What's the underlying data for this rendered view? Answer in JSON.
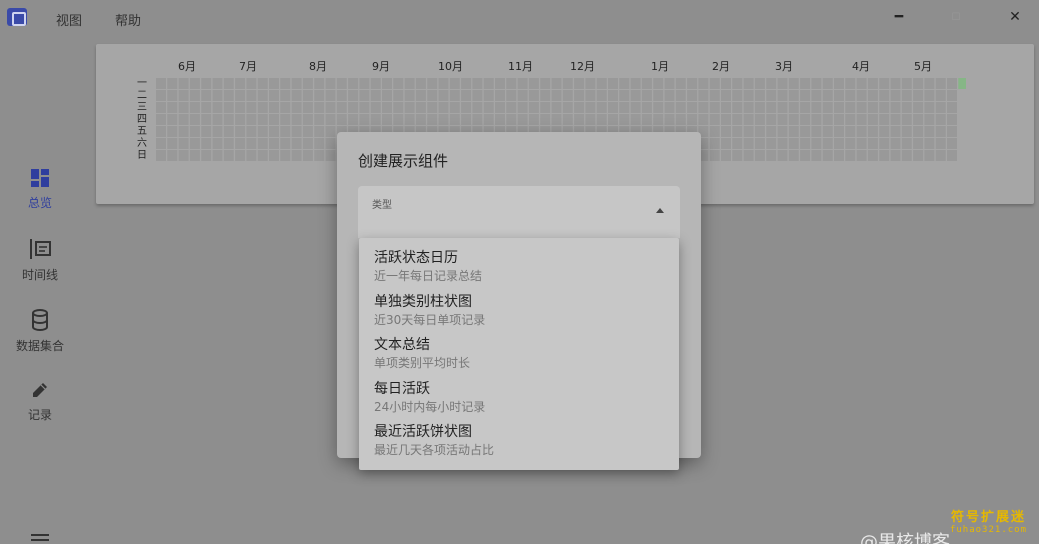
{
  "menu": {
    "view": "视图",
    "help": "帮助"
  },
  "window": {
    "minimize": "━",
    "maximize": "☐",
    "close": "✕"
  },
  "nav": [
    {
      "label": "总览",
      "icon": "dashboard-icon",
      "active": true
    },
    {
      "label": "时间线",
      "icon": "timeline-icon",
      "active": false
    },
    {
      "label": "数据集合",
      "icon": "database-icon",
      "active": false
    },
    {
      "label": "记录",
      "icon": "pencil-icon",
      "active": false
    }
  ],
  "heatmap": {
    "months": [
      "6月",
      "7月",
      "8月",
      "9月",
      "10月",
      "11月",
      "12月",
      "1月",
      "2月",
      "3月",
      "4月",
      "5月"
    ],
    "days": [
      "一",
      "二",
      "三",
      "四",
      "五",
      "六",
      "日"
    ],
    "cell_color": "#999999",
    "active_color": "#86b686"
  },
  "dialog": {
    "title": "创建展示组件",
    "select_label": "类型"
  },
  "options": [
    {
      "title": "活跃状态日历",
      "subtitle": "近一年每日记录总结"
    },
    {
      "title": "单独类别柱状图",
      "subtitle": "近30天每日单项记录"
    },
    {
      "title": "文本总结",
      "subtitle": "单项类别平均时长"
    },
    {
      "title": "每日活跃",
      "subtitle": "24小时内每小时记录"
    },
    {
      "title": "最近活跃饼状图",
      "subtitle": "最近几天各项活动占比"
    }
  ],
  "watermark": {
    "main": "符号扩展迷",
    "url": "fuhao321.com",
    "bottom": "@果核博客"
  },
  "colors": {
    "accent": "#2f3e9e"
  }
}
